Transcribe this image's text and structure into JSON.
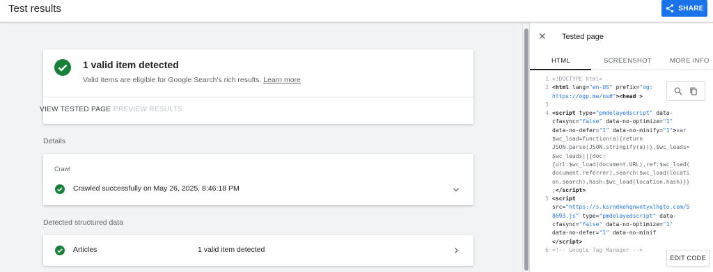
{
  "header": {
    "title": "Test results",
    "share_label": "SHARE"
  },
  "summary": {
    "title": "1 valid item detected",
    "description": "Valid items are eligible for Google Search's rich results.",
    "learn_more": "Learn more",
    "view_tested_page": "VIEW TESTED PAGE",
    "preview_results": "PREVIEW RESULTS"
  },
  "details": {
    "heading": "Details",
    "crawl_label": "Crawl",
    "crawl_status": "Crawled successfully on May 26, 2025, 8:46:18 PM"
  },
  "structured": {
    "heading": "Detected structured data",
    "item_label": "Articles",
    "item_status": "1 valid item detected"
  },
  "panel": {
    "title": "Tested page",
    "tabs": [
      {
        "label": "HTML"
      },
      {
        "label": "SCREENSHOT"
      },
      {
        "label": "MORE INFO"
      }
    ],
    "edit_code": "EDIT CODE"
  },
  "colors": {
    "accent": "#1a73e8",
    "success": "#188038"
  },
  "icons": [
    "share-icon",
    "check-circle-icon",
    "chevron-down-icon",
    "chevron-right-icon",
    "close-icon",
    "search-icon",
    "copy-icon"
  ]
}
